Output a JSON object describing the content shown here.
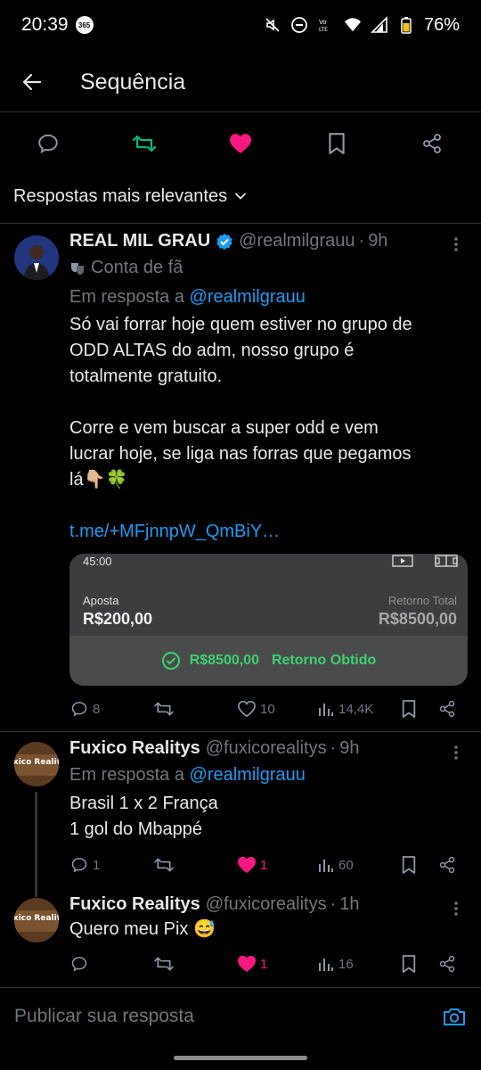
{
  "status_bar": {
    "time": "20:39",
    "badge": "365",
    "battery": "76%",
    "icons": [
      "mute-icon",
      "dnd-icon",
      "volte-icon",
      "wifi-icon",
      "signal-icon",
      "battery-icon"
    ]
  },
  "header": {
    "title": "Sequência",
    "back_icon": "arrow-left-icon"
  },
  "actions": {
    "icons": [
      "reply-icon",
      "retweet-icon",
      "like-icon",
      "bookmark-icon",
      "share-icon"
    ],
    "retweet_color": "#00ba7c",
    "like_color": "#f91880"
  },
  "sort": {
    "label": "Respostas mais relevantes"
  },
  "tweets": [
    {
      "name": "REAL MIL GRAU",
      "handle": "@realmilgrauu",
      "time": "9h",
      "fan_label": "Conta de fã",
      "reply_prefix": "Em resposta a",
      "reply_handle": "@realmilgrauu",
      "line1": "Só vai forrar hoje quem estiver no grupo de",
      "line2": "ODD ALTAS do adm, nosso grupo é",
      "line3": "totalmente gratuito.",
      "line4": "Corre e vem buscar a super odd e vem",
      "line5": "lucrar hoje, se liga nas forras que pegamos",
      "line6": "lá👇🏼🍀",
      "link": "t.me/+MFjnnpW_QmBiY…",
      "media": {
        "time": "45:00",
        "aposta_label": "Aposta",
        "aposta_value": "R$200,00",
        "retorno_label": "Retorno Total",
        "retorno_value": "R$8500,00",
        "result_amount": "R$8500,00",
        "result_label": "Retorno Obtido"
      },
      "replies": "8",
      "retweets": "",
      "likes": "10",
      "views": "14,4K"
    },
    {
      "name": "Fuxico Realitys",
      "handle": "@fuxicorealitys",
      "time": "9h",
      "avatar_text": "Fuxico Realitys",
      "reply_prefix": "Em resposta a",
      "reply_handle": "@realmilgrauu",
      "line1": "Brasil 1 x 2 França",
      "line2": "1 gol do Mbappé",
      "replies": "1",
      "retweets": "",
      "likes": "1",
      "views": "60"
    },
    {
      "name": "Fuxico Realitys",
      "handle": "@fuxicorealitys",
      "time": "1h",
      "avatar_text": "Fuxico Realitys",
      "line1": "Quero meu Pix 😅",
      "replies": "",
      "retweets": "",
      "likes": "1",
      "views": "16"
    }
  ],
  "composer": {
    "placeholder": "Publicar sua resposta"
  }
}
